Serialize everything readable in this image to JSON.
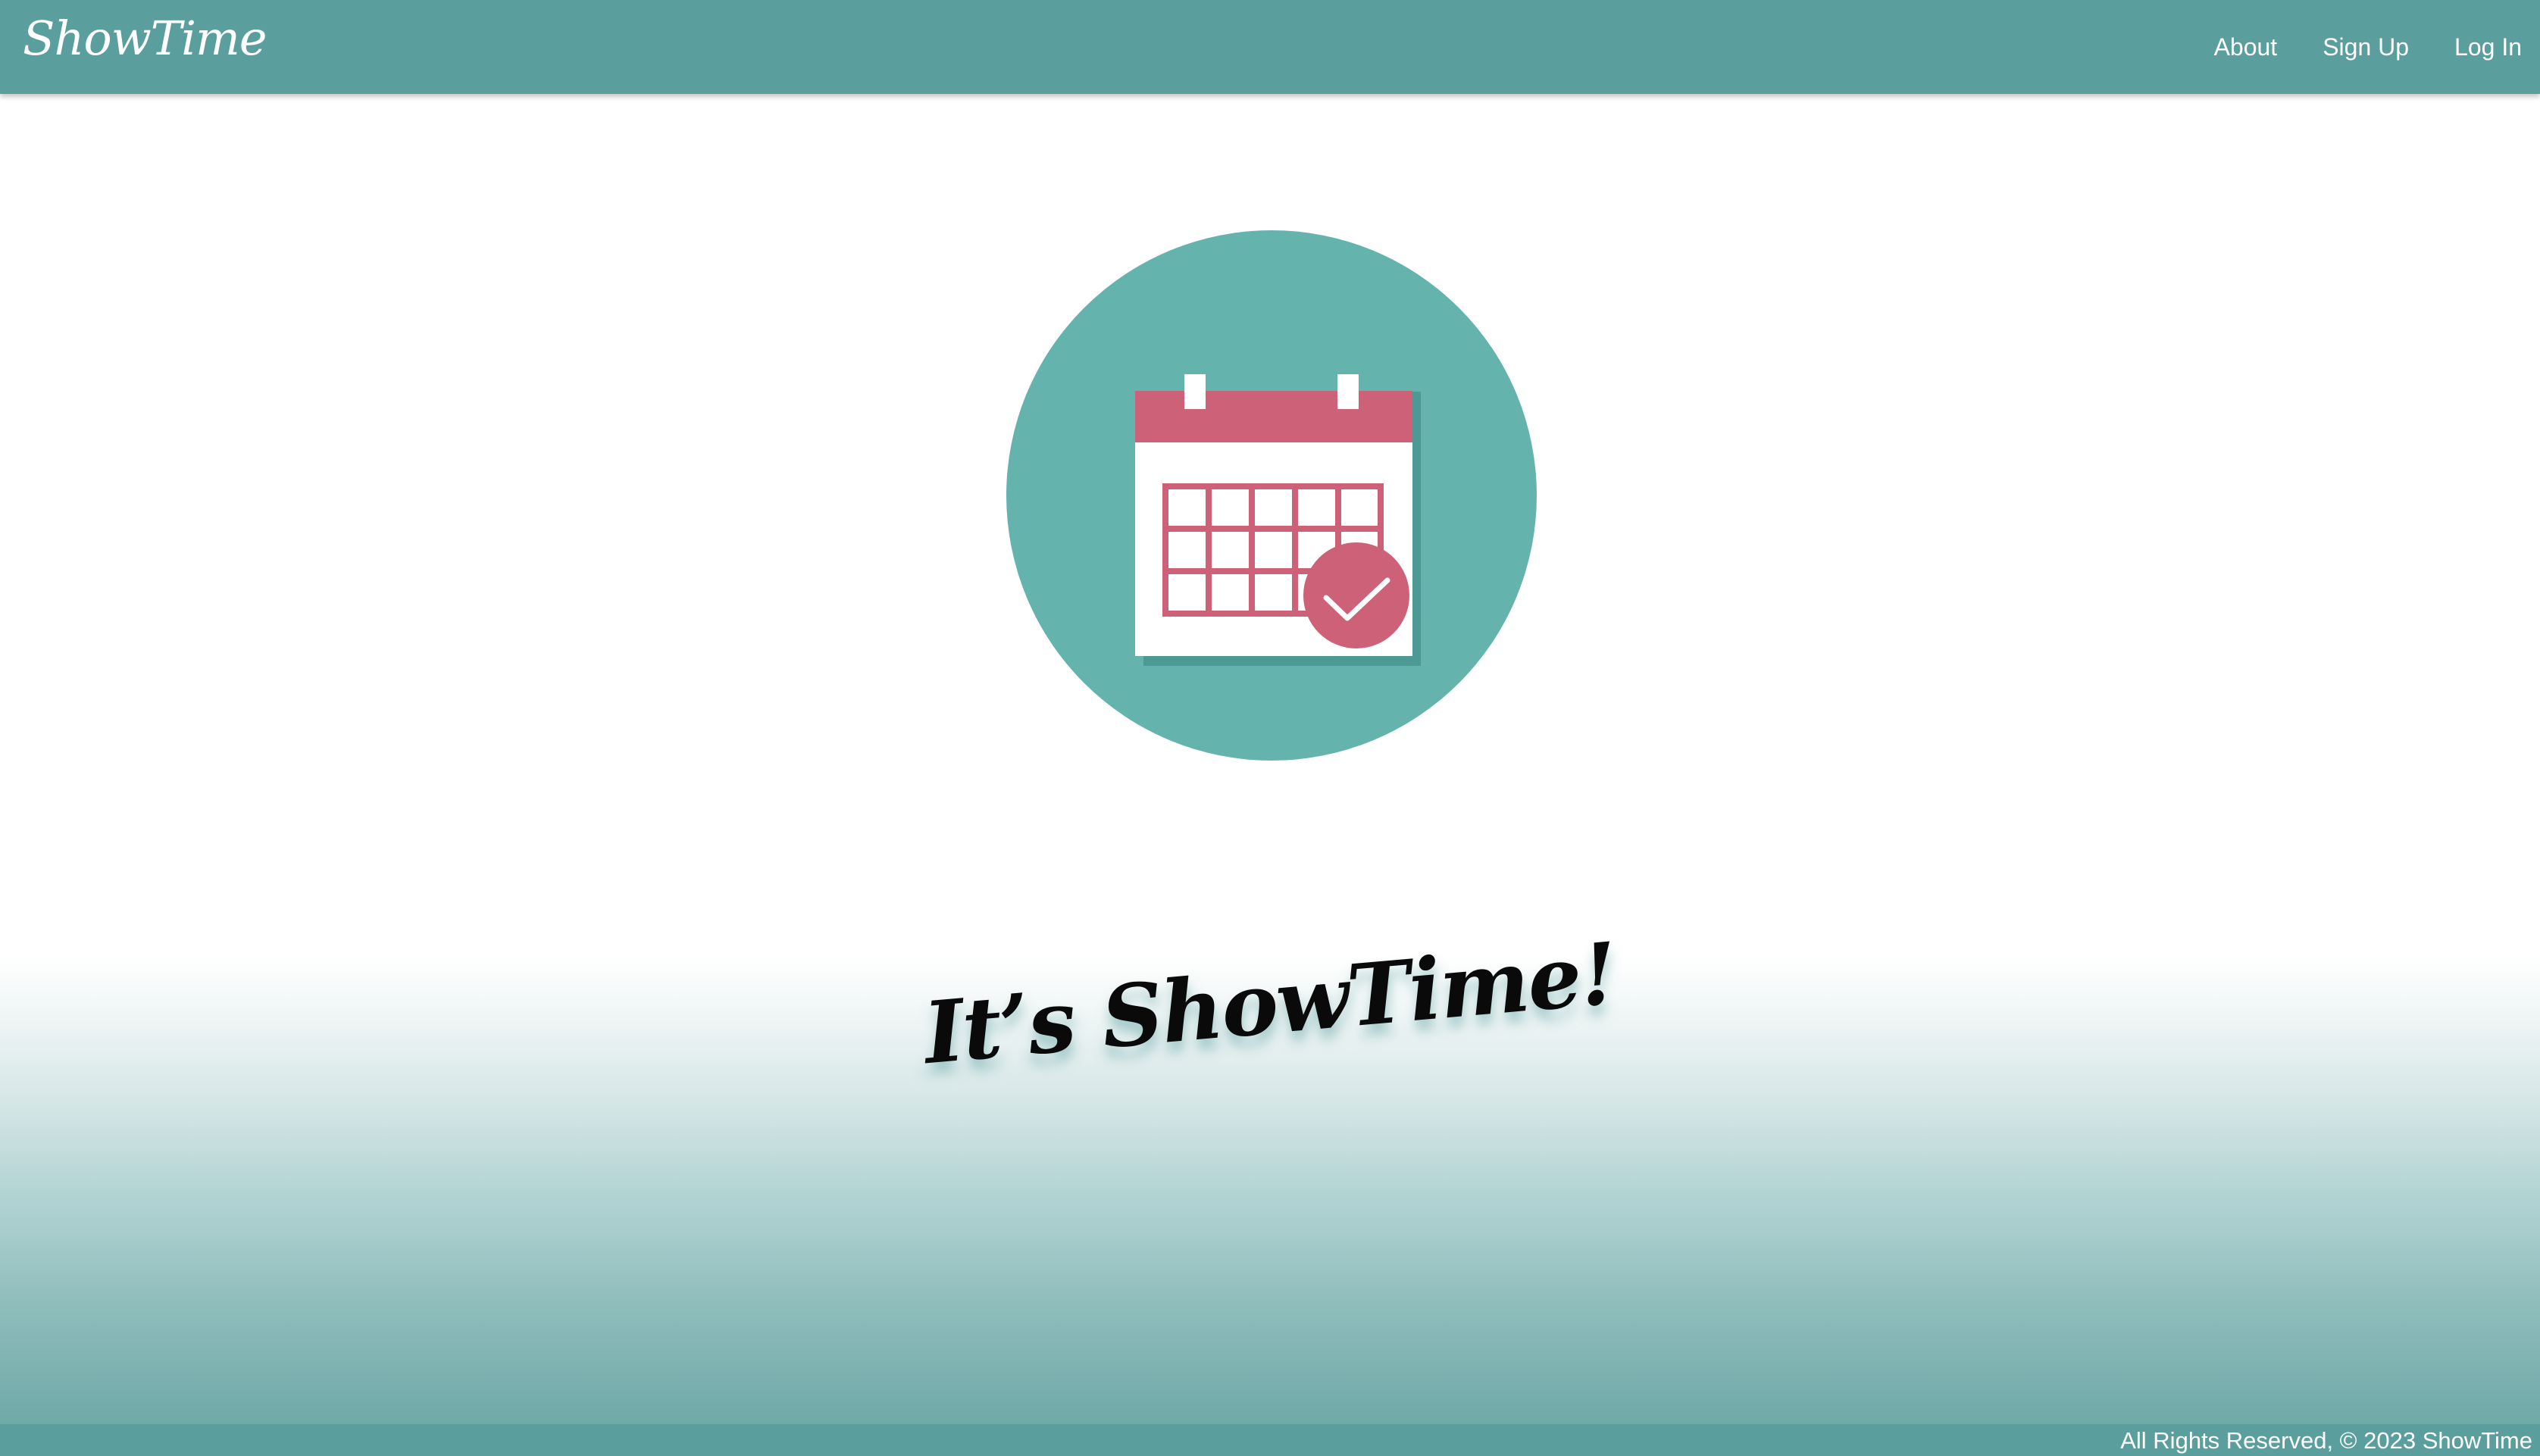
{
  "header": {
    "brand": "ShowTime",
    "nav": [
      {
        "label": "About"
      },
      {
        "label": "Sign Up"
      },
      {
        "label": "Log In"
      }
    ]
  },
  "hero": {
    "icon": "calendar-check-icon",
    "headline": "It’s ShowTime!"
  },
  "footer": {
    "text": "All Rights Reserved, © 2023 ShowTime"
  },
  "colors": {
    "primary": "#5b9e9e",
    "circle": "#64b4ad",
    "calendar_accent": "#cc6178",
    "calendar_shadow": "#4d9a94"
  }
}
